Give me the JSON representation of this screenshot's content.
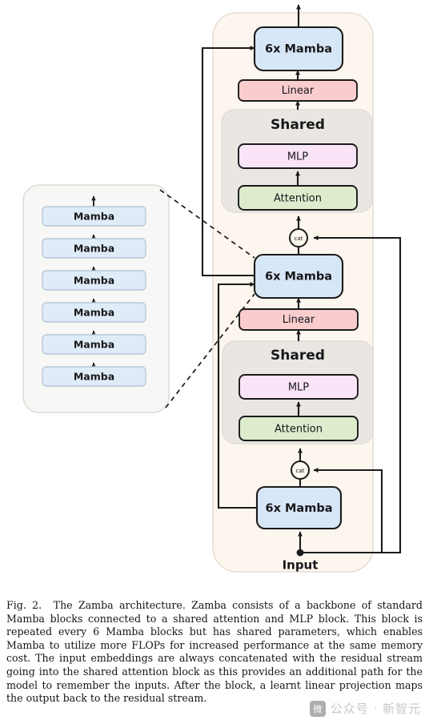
{
  "figure": {
    "title": "The Zamba architecture diagram",
    "colors": {
      "mamba_fill": "#d8e7f7",
      "mamba_small_fill": "#dfecf8",
      "linear_fill": "#f9ccce",
      "mlp_fill": "#fae4f7",
      "attention_fill": "#dceccd",
      "shared_fill": "#eae7e3",
      "backbone_fill": "#fdf6ee",
      "left_panel_fill": "#f7f7f5",
      "stroke": "#1b1b1b",
      "soft_stroke": "#b9c8d6",
      "panel_stroke": "#d8d8d4"
    },
    "left_panel": {
      "name": "mamba-stack",
      "blocks": [
        {
          "label": "Mamba"
        },
        {
          "label": "Mamba"
        },
        {
          "label": "Mamba"
        },
        {
          "label": "Mamba"
        },
        {
          "label": "Mamba"
        },
        {
          "label": "Mamba"
        }
      ]
    },
    "backbone": {
      "name": "zamba-backbone",
      "input_label": "Input",
      "concat_label": "cat",
      "layers": [
        {
          "id": "upper",
          "mamba_label": "6x Mamba",
          "linear_label": "Linear",
          "shared_label": "Shared",
          "mlp_label": "MLP",
          "attention_label": "Attention"
        },
        {
          "id": "lower",
          "mamba_label": "6x Mamba",
          "linear_label": "Linear",
          "shared_label": "Shared",
          "mlp_label": "MLP",
          "attention_label": "Attention"
        }
      ],
      "bottom_mamba_label": "6x Mamba"
    }
  },
  "caption": {
    "number": "Fig. 2.",
    "text": "The Zamba architecture. Zamba consists of a backbone of standard Mamba blocks connected to a shared attention and MLP block. This block is repeated every 6 Mamba blocks but has shared parameters, which enables Mamba to utilize more FLOPs for increased performance at the same memory cost. The input embeddings are always concatenated with the residual stream going into the shared attention block as this provides an additional path for the model to remember the inputs. After the block, a learnt linear projection maps the output back to the residual stream."
  },
  "watermark": {
    "badge": "微",
    "text": "公众号 · 新智元"
  }
}
